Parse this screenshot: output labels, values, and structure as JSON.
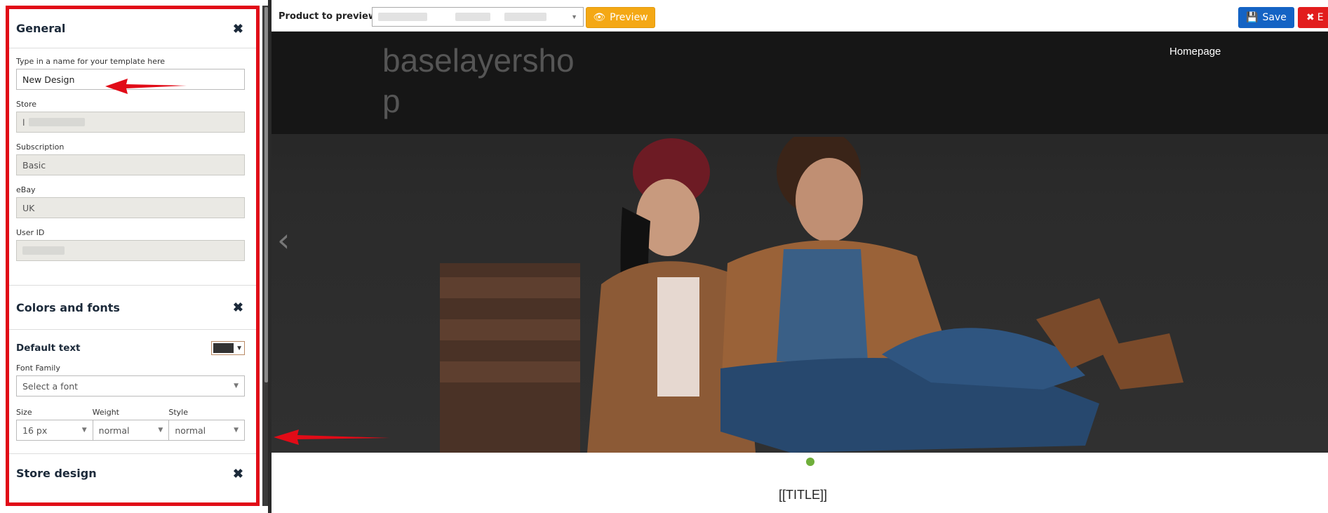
{
  "panel": {
    "general": {
      "title": "General",
      "template_name_label": "Type in a name for your template here",
      "template_name_value": "New Design",
      "store_label": "Store",
      "store_value": "l",
      "subscription_label": "Subscription",
      "subscription_value": "Basic",
      "ebay_label": "eBay",
      "ebay_value": "UK",
      "user_id_label": "User ID"
    },
    "colors_fonts": {
      "title": "Colors and fonts",
      "default_text_label": "Default text",
      "default_text_color": "#333333",
      "font_family_label": "Font Family",
      "font_family_placeholder": "Select a font",
      "size_label": "Size",
      "size_value": "16 px",
      "weight_label": "Weight",
      "weight_value": "normal",
      "style_label": "Style",
      "style_value": "normal"
    },
    "store_design": {
      "title": "Store design"
    }
  },
  "toolbar": {
    "product_preview_label": "Product to preview:",
    "preview_label": "Preview",
    "save_label": "Save",
    "exit_label": "E"
  },
  "preview": {
    "store_name": "baselayershop",
    "nav_home": "Homepage",
    "title_token": "[[TITLE]]"
  },
  "colors": {
    "panel_border": "#e10b17",
    "preview_button": "#f4a815",
    "save_button": "#1463c4",
    "exit_button": "#e21d1d",
    "slider_dot": "#6fae3a"
  }
}
